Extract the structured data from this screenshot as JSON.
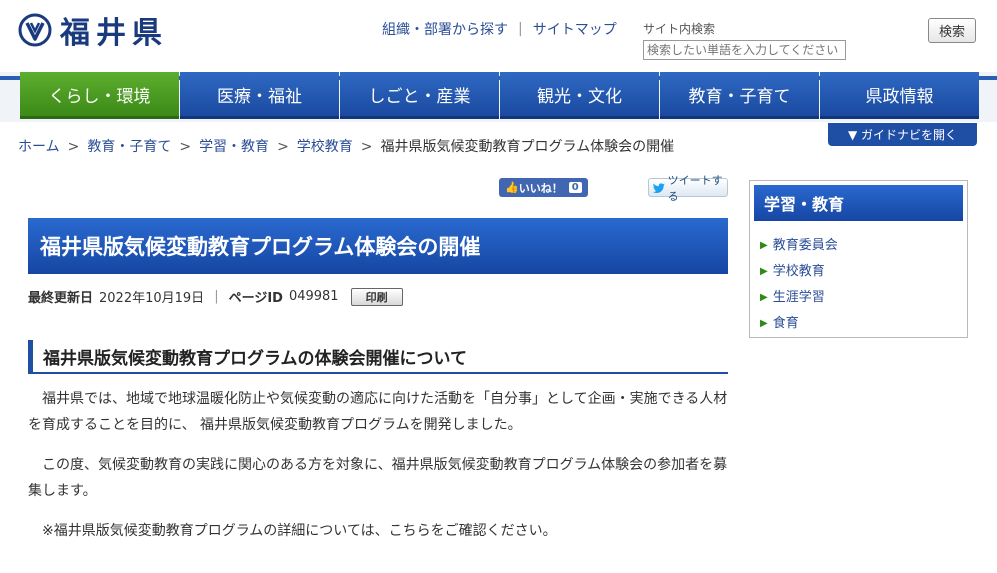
{
  "header": {
    "logo_text": "福井県",
    "links": [
      "組織・部署から探す",
      "サイトマップ"
    ],
    "search_label": "サイト内検索",
    "search_placeholder": "検索したい単語を入力してください",
    "search_button": "検索"
  },
  "nav": [
    {
      "label": "くらし・環境",
      "active": true
    },
    {
      "label": "医療・福祉",
      "active": false
    },
    {
      "label": "しごと・産業",
      "active": false
    },
    {
      "label": "観光・文化",
      "active": false
    },
    {
      "label": "教育・子育て",
      "active": false
    },
    {
      "label": "県政情報",
      "active": false
    }
  ],
  "breadcrumb": [
    "ホーム",
    "教育・子育て",
    "学習・教育",
    "学校教育",
    "福井県版気候変動教育プログラム体験会の開催"
  ],
  "guide_button": "▼ ガイドナビを開く",
  "social": {
    "like_label": "いいね！",
    "like_count": "0",
    "tweet_label": "ツイートする"
  },
  "page": {
    "title": "福井県版気候変動教育プログラム体験会の開催",
    "updated_label": "最終更新日",
    "updated_date": "2022年10月19日",
    "page_id_label": "ページID",
    "page_id": "049981",
    "print_label": "印刷",
    "heading": "福井県版気候変動教育プログラムの体験会開催について",
    "paragraphs": [
      "福井県では、地域で地球温暖化防止や気候変動の適応に向けた活動を「自分事」として企画・実施できる人材を育成することを目的に、 福井県版気候変動教育プログラムを開発しました。",
      "この度、気候変動教育の実践に関心のある方を対象に、福井県版気候変動教育プログラム体験会の参加者を募集します。",
      "※福井県版気候変動教育プログラムの詳細については、こちらをご確認ください。"
    ]
  },
  "sidebar": {
    "title": "学習・教育",
    "items": [
      "教育委員会",
      "学校教育",
      "生涯学習",
      "食育"
    ]
  },
  "colors": {
    "brand_blue": "#1f4fa5",
    "active_green": "#4a9c22"
  }
}
